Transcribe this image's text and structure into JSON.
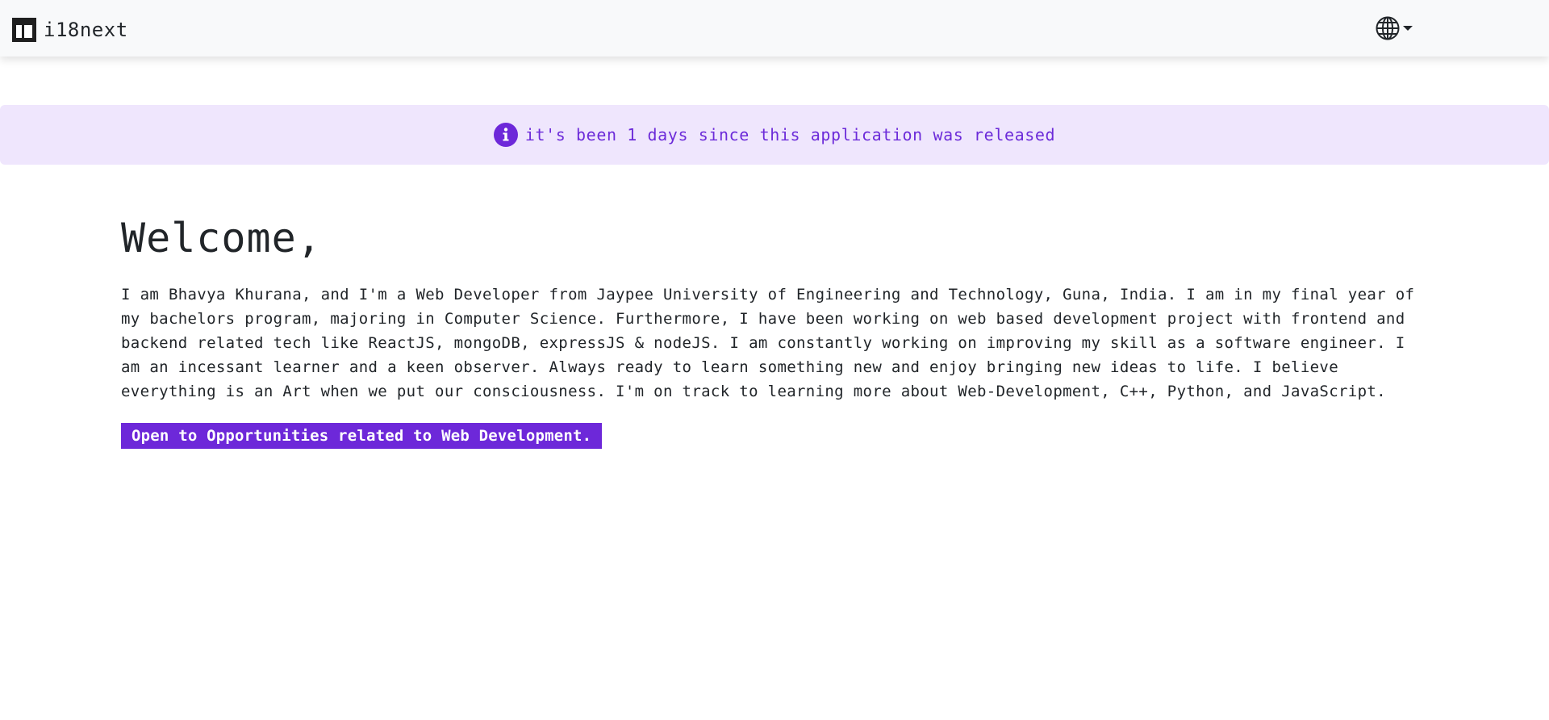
{
  "navbar": {
    "brand_text": "i18next",
    "brand_icon": "npm-logo-icon",
    "language_icon": "globe-icon"
  },
  "alert": {
    "icon": "info-icon",
    "text": "it's been 1 days since this application was released",
    "background_color": "#efe6fd",
    "text_color": "#6c2bd9"
  },
  "main": {
    "title": "Welcome,",
    "bio": "I am Bhavya Khurana, and I'm a Web Developer from Jaypee University of Engineering and Technology, Guna, India. I am in my final year of my bachelors program, majoring in Computer Science. Furthermore, I have been working on web based development project with frontend and backend related tech like ReactJS, mongoDB, expressJS & nodeJS. I am constantly working on improving my skill as a software engineer. I am an incessant learner and a keen observer. Always ready to learn something new and enjoy bringing new ideas to life. I believe everything is an Art when we put our consciousness. I'm on track to learning more about Web-Development, C++, Python, and JavaScript.",
    "badge": "Open to Opportunities related to Web Development.",
    "badge_color": "#6d28d9"
  }
}
